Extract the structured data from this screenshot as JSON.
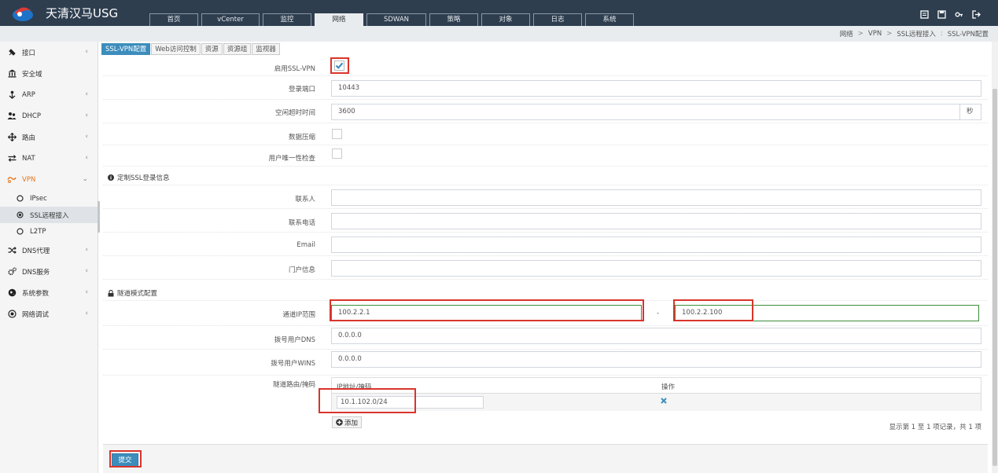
{
  "app": {
    "brand": "天清汉马USG"
  },
  "topnav": {
    "tabs": [
      "首页",
      "vCenter",
      "监控",
      "网络",
      "SDWAN",
      "策略",
      "对象",
      "日志",
      "系统"
    ],
    "active": "网络"
  },
  "top_icons": [
    "clipboard-icon",
    "save-icon",
    "key-icon",
    "logout-icon"
  ],
  "breadcrumb": {
    "parts": [
      "网络",
      "VPN",
      "SSL远程接入",
      "SSL-VPN配置"
    ]
  },
  "sidebar": {
    "items": [
      {
        "label": "接口",
        "icon": "plug-icon",
        "expandable": true
      },
      {
        "label": "安全域",
        "icon": "bank-icon",
        "expandable": false
      },
      {
        "label": "ARP",
        "icon": "arp-icon",
        "expandable": true
      },
      {
        "label": "DHCP",
        "icon": "users-icon",
        "expandable": true
      },
      {
        "label": "路由",
        "icon": "arrows-icon",
        "expandable": true
      },
      {
        "label": "NAT",
        "icon": "exchange-icon",
        "expandable": true
      },
      {
        "label": "VPN",
        "icon": "vpn-icon",
        "expandable": true,
        "expanded": true
      },
      {
        "label": "DNS代理",
        "icon": "random-icon",
        "expandable": true
      },
      {
        "label": "DNS服务",
        "icon": "cogs-icon",
        "expandable": true
      },
      {
        "label": "系统参数",
        "icon": "globe-icon",
        "expandable": true
      },
      {
        "label": "网络调试",
        "icon": "target-icon",
        "expandable": true
      }
    ],
    "vpn_sub": [
      {
        "label": "IPsec",
        "active": false
      },
      {
        "label": "SSL远程接入",
        "active": true
      },
      {
        "label": "L2TP",
        "active": false
      }
    ]
  },
  "content_tabs": [
    "SSL-VPN配置",
    "Web访问控制",
    "资源",
    "资源组",
    "监视器"
  ],
  "form": {
    "enable_ssl": {
      "label": "启用SSL-VPN",
      "checked": true
    },
    "login_port": {
      "label": "登录端口",
      "value": "10443"
    },
    "idle_timeout": {
      "label": "空闲超时时间",
      "value": "3600",
      "unit": "秒"
    },
    "compression": {
      "label": "数据压缩",
      "checked": false
    },
    "user_unique": {
      "label": "用户唯一性检查",
      "checked": false
    },
    "custom_section": "定制SSL登录信息",
    "contact": {
      "label": "联系人",
      "value": ""
    },
    "phone": {
      "label": "联系电话",
      "value": ""
    },
    "email": {
      "label": "Email",
      "value": ""
    },
    "portal_info": {
      "label": "门户信息",
      "value": ""
    },
    "tunnel_section": "隧道模式配置",
    "tunnel_ip": {
      "label": "通道IP范围",
      "start": "100.2.2.1",
      "end": "100.2.2.100",
      "dash": "-"
    },
    "dial_dns": {
      "label": "拨号用户DNS",
      "value": "0.0.0.0"
    },
    "dial_wins": {
      "label": "拨号用户WINS",
      "value": "0.0.0.0"
    },
    "tunnel_route": {
      "label": "隧道路由/掩码",
      "col_ip": "IP地址/掩码",
      "col_op": "操作",
      "rows": [
        {
          "ip": "10.1.102.0/24"
        }
      ]
    },
    "add_button": "添加",
    "page_info": "显示第 1 至 1 项记录，共 1 项",
    "submit": "提交"
  },
  "colors": {
    "topbar": "#2e3e4f",
    "accent": "#3c8dbc",
    "vpn_active": "#e6751a",
    "highlight": "#d9342b"
  }
}
